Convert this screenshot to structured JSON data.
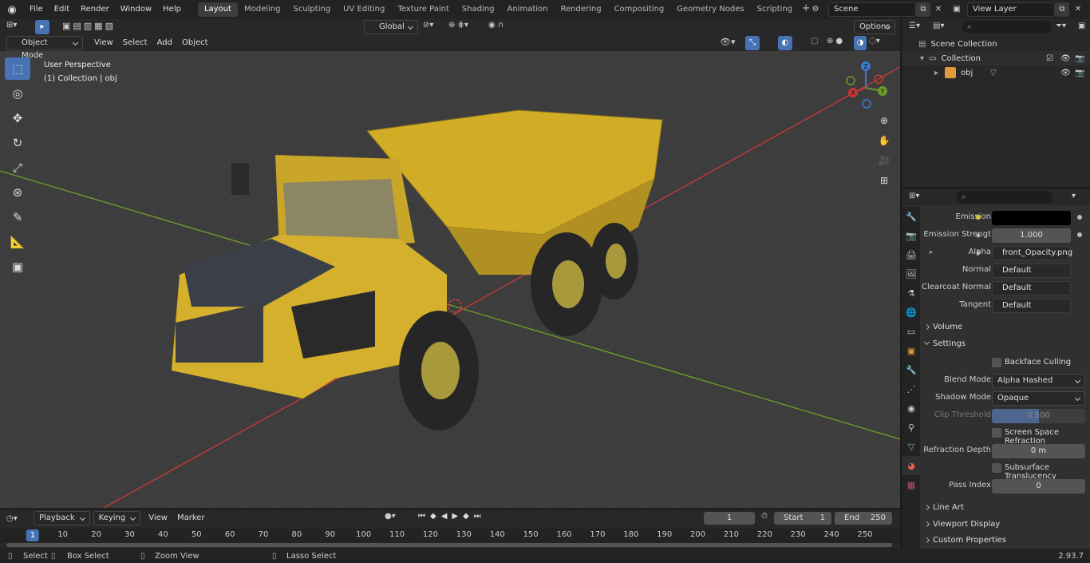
{
  "menu": [
    "File",
    "Edit",
    "Render",
    "Window",
    "Help"
  ],
  "workspaces": [
    {
      "label": "Layout",
      "active": true
    },
    {
      "label": "Modeling"
    },
    {
      "label": "Sculpting"
    },
    {
      "label": "UV Editing"
    },
    {
      "label": "Texture Paint"
    },
    {
      "label": "Shading"
    },
    {
      "label": "Animation"
    },
    {
      "label": "Rendering"
    },
    {
      "label": "Compositing"
    },
    {
      "label": "Geometry Nodes"
    },
    {
      "label": "Scripting"
    }
  ],
  "scene_name": "Scene",
  "view_layer": "View Layer",
  "viewport": {
    "mode": "Object Mode",
    "menus": [
      "View",
      "Select",
      "Add",
      "Object"
    ],
    "transform_orientation": "Global",
    "options_label": "Options",
    "perspective_label": "User Perspective",
    "collection_label": "(1) Collection | obj"
  },
  "gizmo": {
    "x": "X",
    "y": "Y",
    "z": "Z"
  },
  "outliner": {
    "scene_collection": "Scene Collection",
    "collection": "Collection",
    "object": "obj"
  },
  "properties": {
    "emission_label": "Emission",
    "emission_strength_label": "Emission Strengt",
    "emission_strength_value": "1.000",
    "alpha_label": "Alpha",
    "alpha_value": "front_Opacity.png",
    "normal_label": "Normal",
    "normal_value": "Default",
    "clearcoat_normal_label": "Clearcoat Normal",
    "clearcoat_normal_value": "Default",
    "tangent_label": "Tangent",
    "tangent_value": "Default",
    "volume_label": "Volume",
    "settings_label": "Settings",
    "backface_culling_label": "Backface Culling",
    "blend_mode_label": "Blend Mode",
    "blend_mode_value": "Alpha Hashed",
    "shadow_mode_label": "Shadow Mode",
    "shadow_mode_value": "Opaque",
    "clip_threshold_label": "Clip Threshold",
    "clip_threshold_value": "0.500",
    "clip_threshold_fraction": 0.5,
    "ssr_label": "Screen Space Refraction",
    "refraction_depth_label": "Refraction Depth",
    "refraction_depth_value": "0 m",
    "subsurface_label": "Subsurface Translucency",
    "pass_index_label": "Pass Index",
    "pass_index_value": "0",
    "line_art_label": "Line Art",
    "viewport_display_label": "Viewport Display",
    "custom_properties_label": "Custom Properties"
  },
  "timeline": {
    "menus": [
      "Playback",
      "Keying",
      "View",
      "Marker"
    ],
    "current_frame": "1",
    "start_label": "Start",
    "start_value": "1",
    "end_label": "End",
    "end_value": "250",
    "ticks": [
      "10",
      "20",
      "30",
      "40",
      "50",
      "60",
      "70",
      "80",
      "90",
      "100",
      "110",
      "120",
      "130",
      "140",
      "150",
      "160",
      "170",
      "180",
      "190",
      "200",
      "210",
      "220",
      "230",
      "240",
      "250"
    ],
    "current_tick": "1"
  },
  "statusbar": {
    "select": "Select",
    "box_select": "Box Select",
    "zoom_view": "Zoom View",
    "lasso_select": "Lasso Select",
    "version": "2.93.7"
  },
  "colors": {
    "accent": "#4772b3",
    "truck": "#d8b52c",
    "x_axis": "#c33a3a",
    "y_axis": "#6a9a2a"
  }
}
